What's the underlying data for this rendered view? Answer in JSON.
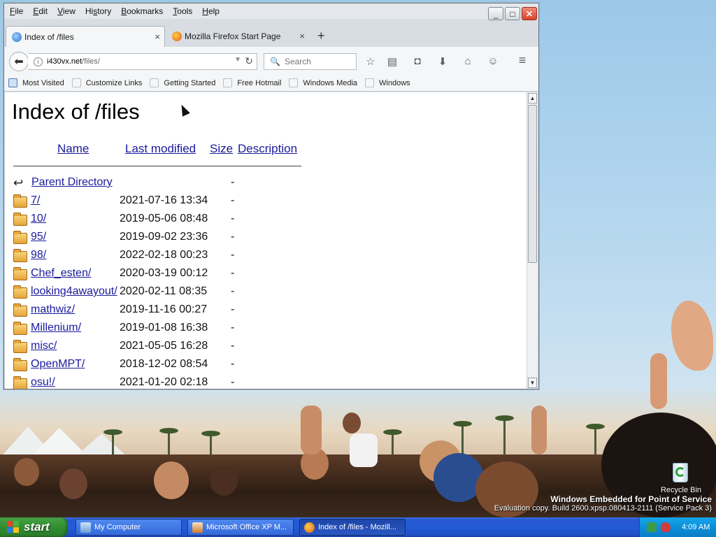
{
  "desktop": {
    "recycle_bin_label": "Recycle Bin",
    "watermark_line1": "Windows Embedded for Point of Service",
    "watermark_line2": "Evaluation copy. Build 2600.xpsp.080413-2111 (Service Pack 3)"
  },
  "browser": {
    "menu": [
      "File",
      "Edit",
      "View",
      "History",
      "Bookmarks",
      "Tools",
      "Help"
    ],
    "menu_mnemonics": [
      "F",
      "E",
      "V",
      "s",
      "B",
      "T",
      "H"
    ],
    "window_controls": {
      "minimize": "_",
      "maximize": "□",
      "close": "✕"
    },
    "tabs": [
      {
        "title": "Index of /files",
        "close": "×",
        "active": true
      },
      {
        "title": "Mozilla Firefox Start Page",
        "close": "×",
        "active": false
      }
    ],
    "new_tab": "+",
    "url": {
      "host": "i430vx.net",
      "path": "/files/"
    },
    "search": {
      "placeholder": "Search"
    },
    "toolbar_icons": [
      "star-icon",
      "reader-list-icon",
      "pocket-icon",
      "download-icon",
      "home-icon",
      "chat-icon",
      "menu-icon"
    ],
    "bookmarks": [
      "Most Visited",
      "Customize Links",
      "Getting Started",
      "Free Hotmail",
      "Windows Media",
      "Windows"
    ]
  },
  "page": {
    "title": "Index of /files",
    "columns": {
      "name": "Name",
      "modified": "Last modified",
      "size": "Size",
      "description": "Description"
    },
    "parent": {
      "name": "Parent Directory",
      "size": "-"
    },
    "entries": [
      {
        "name": "7/",
        "modified": "2021-07-16 13:34",
        "size": "-"
      },
      {
        "name": "10/",
        "modified": "2019-05-06 08:48",
        "size": "-"
      },
      {
        "name": "95/",
        "modified": "2019-09-02 23:36",
        "size": "-"
      },
      {
        "name": "98/",
        "modified": "2022-02-18 00:23",
        "size": "-"
      },
      {
        "name": "Chef_esten/",
        "modified": "2020-03-19 00:12",
        "size": "-"
      },
      {
        "name": "looking4awayout/",
        "modified": "2020-02-11 08:35",
        "size": "-"
      },
      {
        "name": "mathwiz/",
        "modified": "2019-11-16 00:27",
        "size": "-"
      },
      {
        "name": "Millenium/",
        "modified": "2019-01-08 16:38",
        "size": "-"
      },
      {
        "name": "misc/",
        "modified": "2021-05-05 16:28",
        "size": "-"
      },
      {
        "name": "OpenMPT/",
        "modified": "2018-12-02 08:54",
        "size": "-"
      },
      {
        "name": "osu!/",
        "modified": "2021-01-20 02:18",
        "size": "-"
      }
    ]
  },
  "taskbar": {
    "start_label": "start",
    "tasks": [
      {
        "label": "My Computer",
        "active": false
      },
      {
        "label": "Microsoft Office XP M...",
        "active": false
      },
      {
        "label": "Index of /files - Mozill...",
        "active": true
      }
    ],
    "clock": "4:09 AM"
  },
  "colors": {
    "link": "#1a1a9c",
    "taskbar": "#245bd6",
    "start_green": "#3c9a3c",
    "tray_blue": "#0b8fd9"
  }
}
